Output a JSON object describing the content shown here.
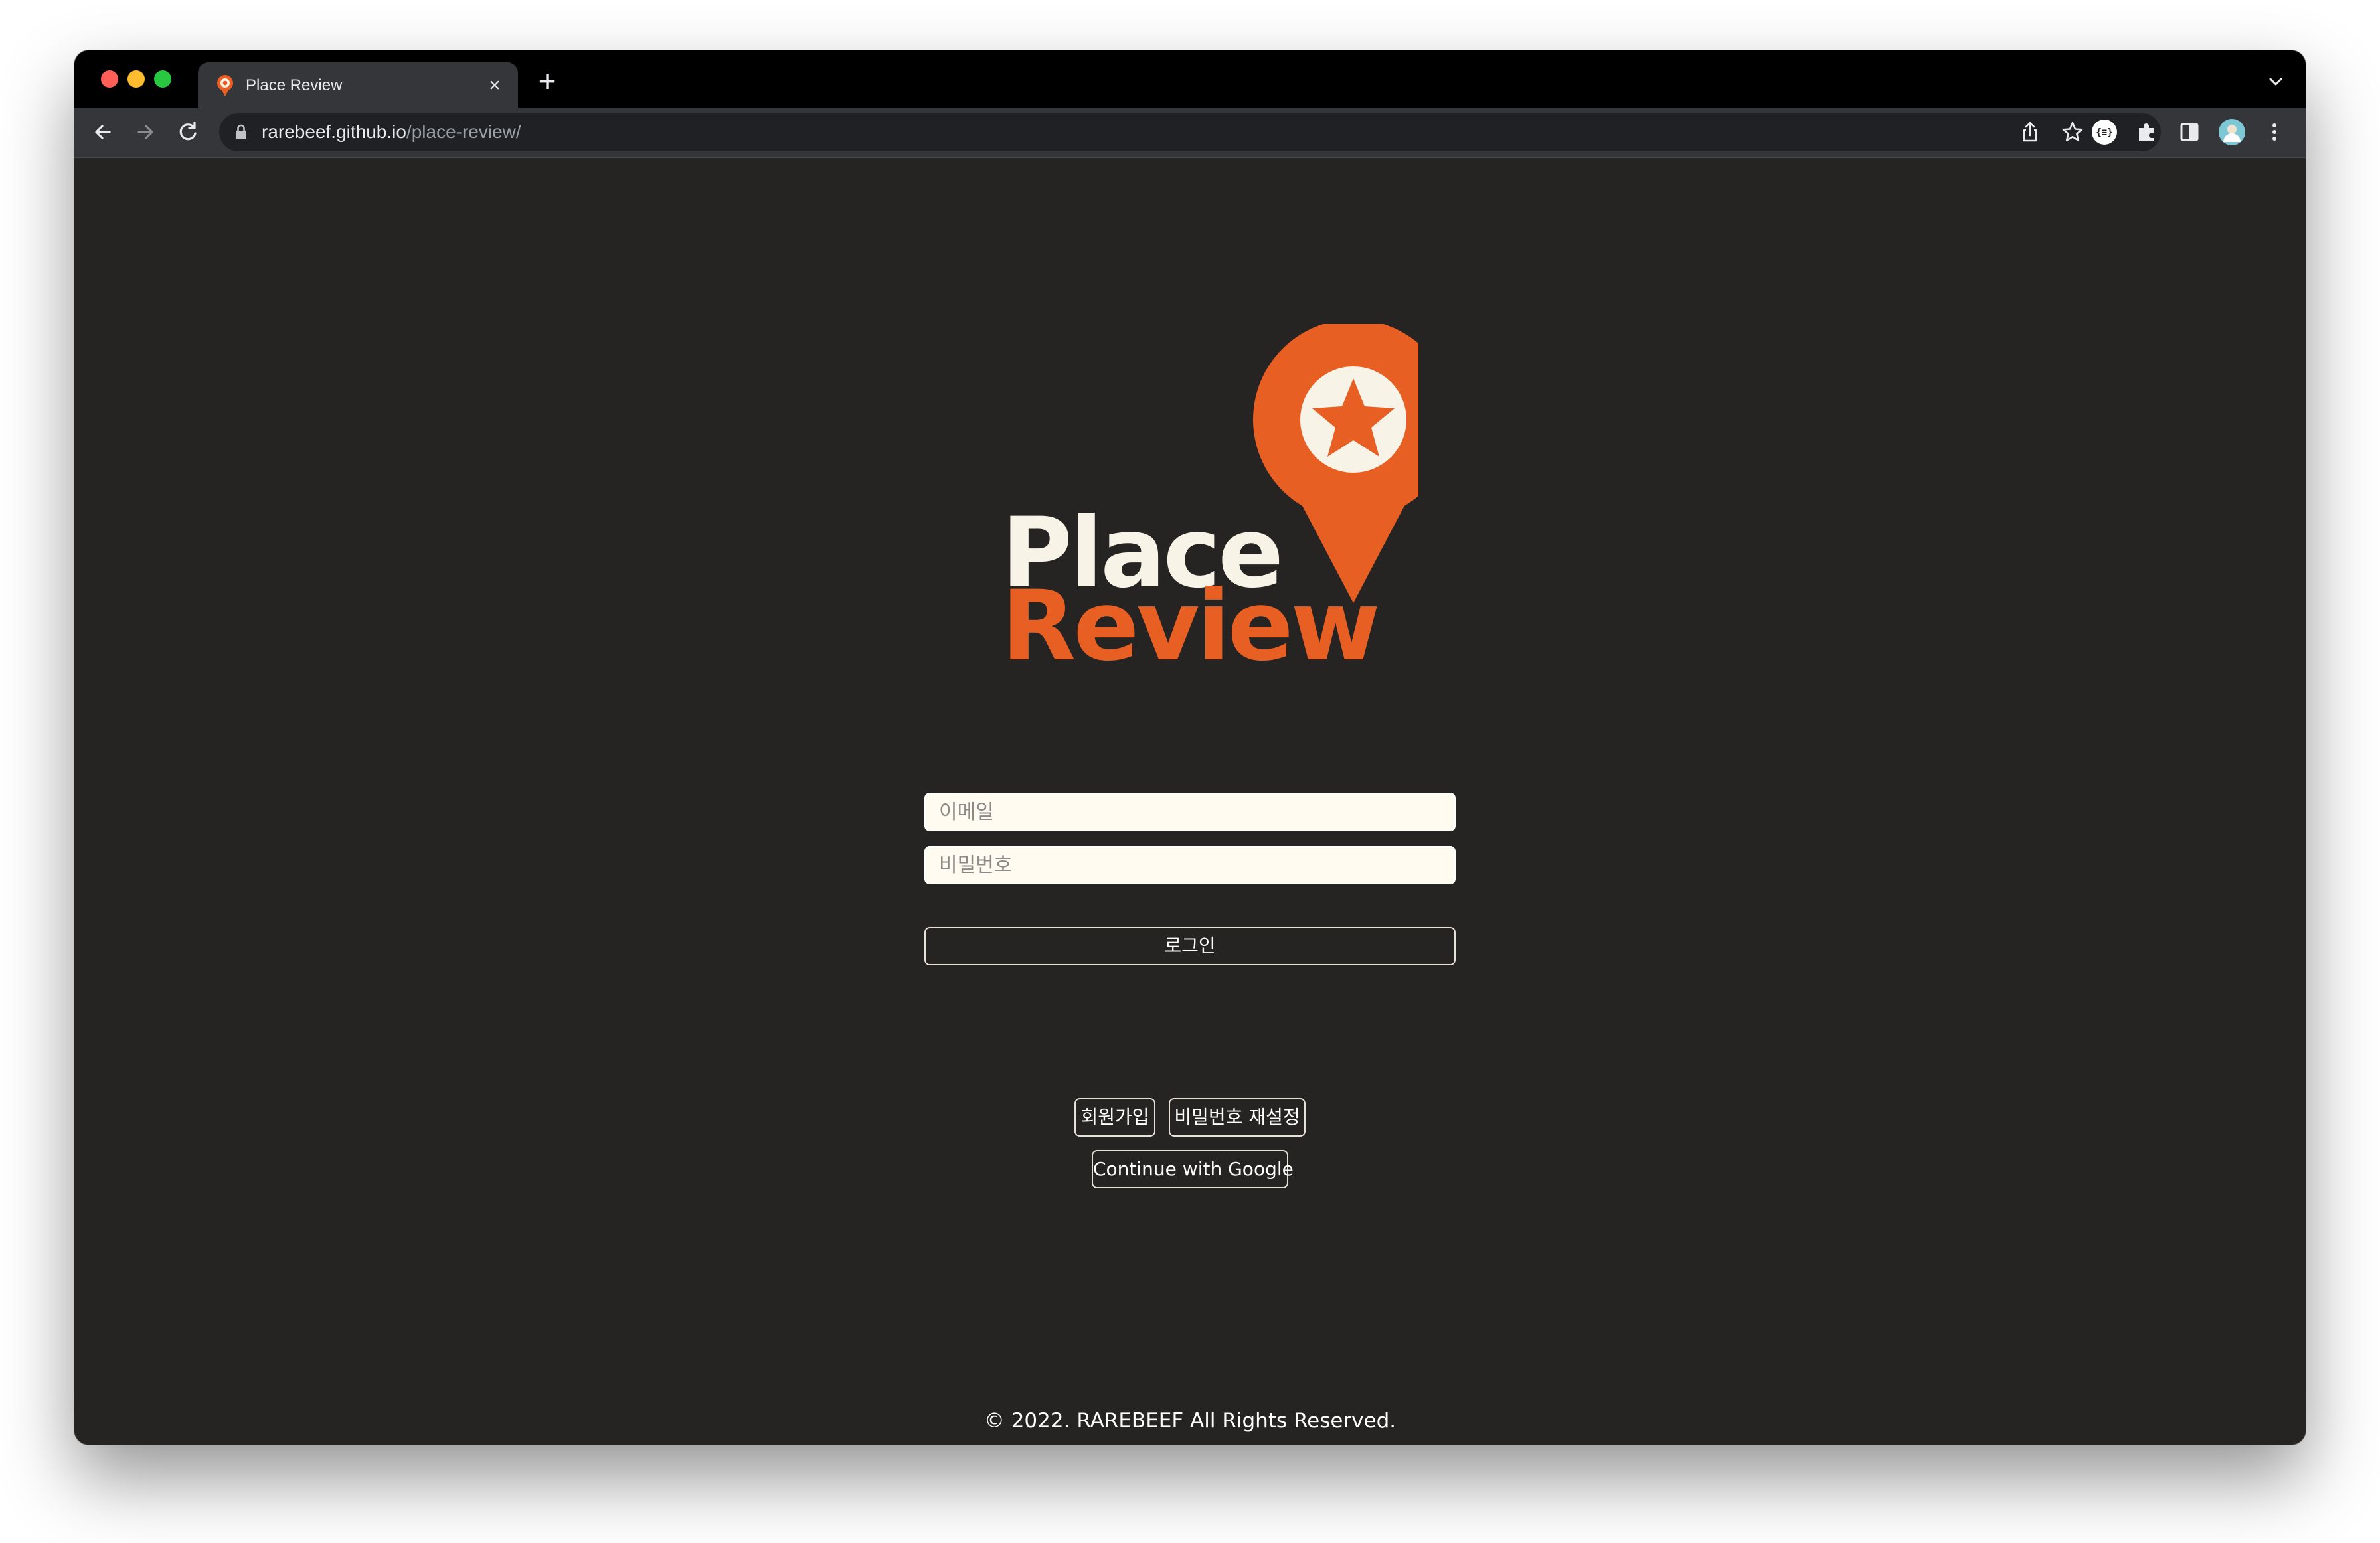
{
  "browser": {
    "tab_title": "Place Review",
    "tab_close": "×",
    "new_tab": "+",
    "url_host": "rarebeef.github.io",
    "url_path": "/place-review/"
  },
  "logo": {
    "line1": "Place",
    "line2": "Review",
    "colors": {
      "accent": "#e85f24",
      "cream": "#f8f3e7"
    }
  },
  "form": {
    "email_placeholder": "이메일",
    "email_value": "",
    "password_placeholder": "비밀번호",
    "password_value": "",
    "login_label": "로그인"
  },
  "links": {
    "signup_label": "회원가입",
    "reset_label": "비밀번호 재설정",
    "google_label": "Continue with Google"
  },
  "footer": {
    "text": "© 2022. RAREBEEF All Rights Reserved."
  },
  "colors": {
    "page_bg": "#252423",
    "field_bg": "#fffbf0"
  }
}
